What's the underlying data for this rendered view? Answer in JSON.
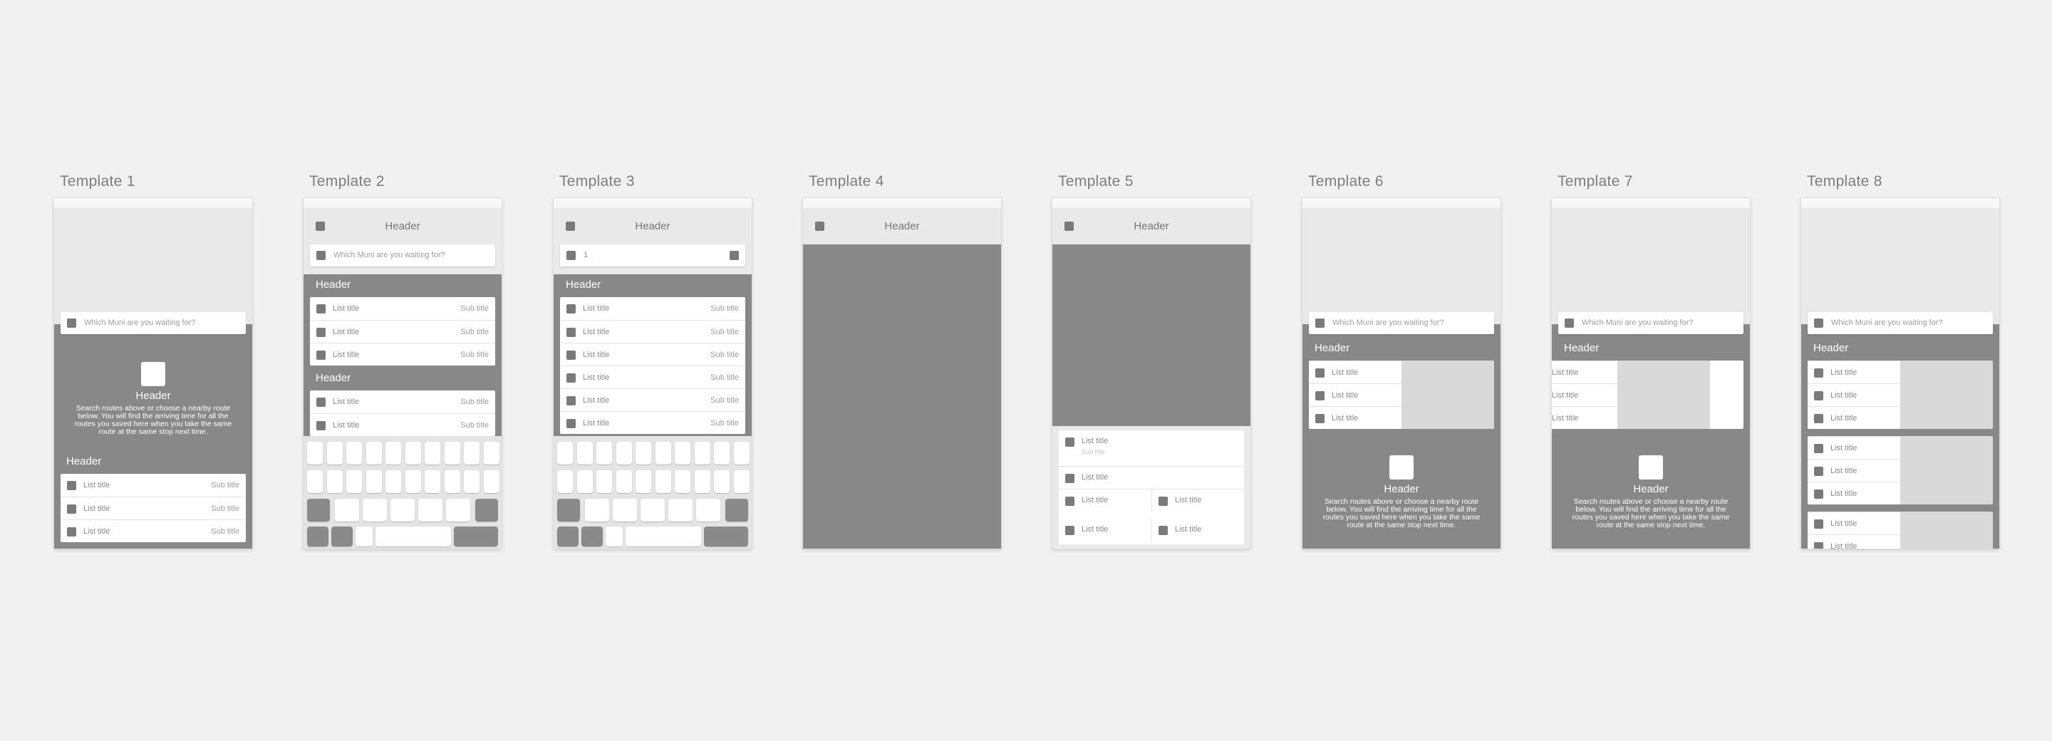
{
  "templates": [
    {
      "label": "Template 1"
    },
    {
      "label": "Template 2"
    },
    {
      "label": "Template 3"
    },
    {
      "label": "Template 4"
    },
    {
      "label": "Template 5"
    },
    {
      "label": "Template 6"
    },
    {
      "label": "Template 7"
    },
    {
      "label": "Template 8"
    }
  ],
  "common": {
    "nav_title": "Header",
    "search_placeholder": "Which Muni are you waiting for?",
    "search_typed": "1",
    "section_header": "Header",
    "list_title": "List title",
    "sub_title": "Sub title",
    "tiny_sub_title": "Sub title",
    "empty_header": "Header",
    "empty_text": "Search routes above or choose a nearby route below. You will find the arriving time for all the routes you saved here when you take the same route at the same stop next time."
  },
  "colors": {
    "canvas": "#f1f1f1",
    "content_dark": "#888888",
    "hero_light": "#e9e9e9",
    "placeholder_square": "#7a7a7a",
    "card": "#ffffff",
    "image_placeholder": "#d9d9d9"
  },
  "icons": {
    "square": "square-placeholder-icon",
    "empty_state": "empty-state-icon"
  }
}
